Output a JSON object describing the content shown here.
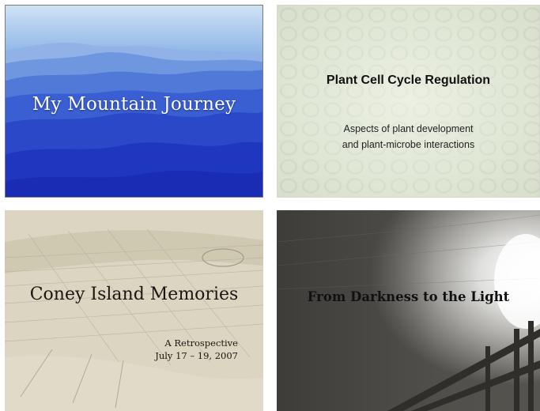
{
  "slides": [
    {
      "id": "mountain",
      "title": "My Mountain Journey",
      "colors": {
        "sky_top": "#b6d4ee",
        "deep": "#1a2fc0",
        "text": "#ffffff"
      }
    },
    {
      "id": "plant",
      "title": "Plant Cell Cycle Regulation",
      "subtitle_line1": "Aspects of plant development",
      "subtitle_line2": "and plant-microbe interactions",
      "colors": {
        "background": "#dfe5d4",
        "text": "#111111"
      }
    },
    {
      "id": "coney",
      "title": "Coney Island Memories",
      "subtitle_line1": "A Retrospective",
      "subtitle_line2": "July 17 – 19, 2007",
      "colors": {
        "background": "#d3cbb5",
        "text": "#1a1712"
      }
    },
    {
      "id": "tunnel",
      "title": "From Darkness to the Light",
      "colors": {
        "dark": "#3e3d3a",
        "light": "#ffffff",
        "text": "#111111"
      }
    }
  ]
}
